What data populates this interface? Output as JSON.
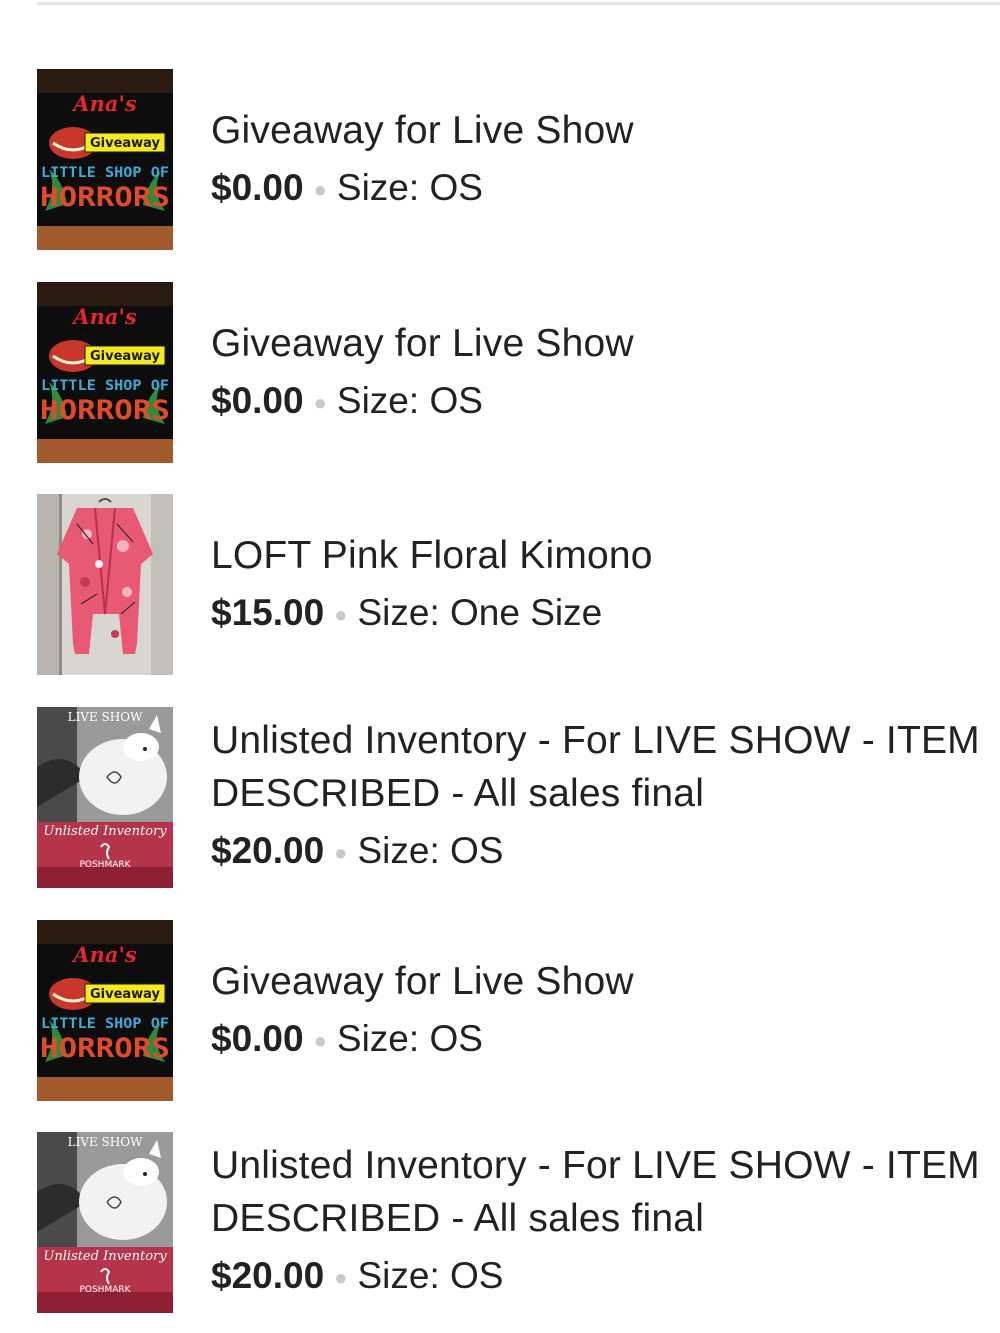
{
  "listings": [
    {
      "image": "giveaway-poster",
      "image_text": {
        "line1": "Ana's",
        "badge": "Giveaway",
        "line2": "LITTLE SHOP OF",
        "line3": "HORRORS"
      },
      "title": "Giveaway for Live Show",
      "title_line2": "",
      "price": "$0.00",
      "size_label": "Size:",
      "size_value": "OS"
    },
    {
      "image": "giveaway-poster",
      "image_text": {
        "line1": "Ana's",
        "badge": "Giveaway",
        "line2": "LITTLE SHOP OF",
        "line3": "HORRORS"
      },
      "title": "Giveaway for Live Show",
      "title_line2": "",
      "price": "$0.00",
      "size_label": "Size:",
      "size_value": "OS"
    },
    {
      "image": "pink-kimono-photo",
      "title": "LOFT Pink Floral Kimono",
      "title_line2": "",
      "price": "$15.00",
      "size_label": "Size:",
      "size_value": "One Size"
    },
    {
      "image": "unlisted-inventory-card",
      "image_text": {
        "top": "LIVE SHOW",
        "script": "Unlisted Inventory",
        "brand": "POSHMARK"
      },
      "title": "Unlisted Inventory - For LIVE SHOW - ITEM",
      "title_line2": "DESCRIBED - All sales final",
      "price": "$20.00",
      "size_label": "Size:",
      "size_value": "OS"
    },
    {
      "image": "giveaway-poster",
      "image_text": {
        "line1": "Ana's",
        "badge": "Giveaway",
        "line2": "LITTLE SHOP OF",
        "line3": "HORRORS"
      },
      "title": "Giveaway for Live Show",
      "title_line2": "",
      "price": "$0.00",
      "size_label": "Size:",
      "size_value": "OS"
    },
    {
      "image": "unlisted-inventory-card",
      "image_text": {
        "top": "LIVE SHOW",
        "script": "Unlisted Inventory",
        "brand": "POSHMARK"
      },
      "title": "Unlisted Inventory - For LIVE SHOW - ITEM",
      "title_line2": "DESCRIBED - All sales final",
      "price": "$20.00",
      "size_label": "Size:",
      "size_value": "OS"
    }
  ],
  "colors": {
    "text": "#222222",
    "separator_dot": "#c9c9c9",
    "divider": "#e6e6e6",
    "poster_bg": "#0d0d0d",
    "poster_band": "#a25a2c",
    "badge_yellow": "#f4ea1f",
    "card_red": "#b6344a"
  }
}
